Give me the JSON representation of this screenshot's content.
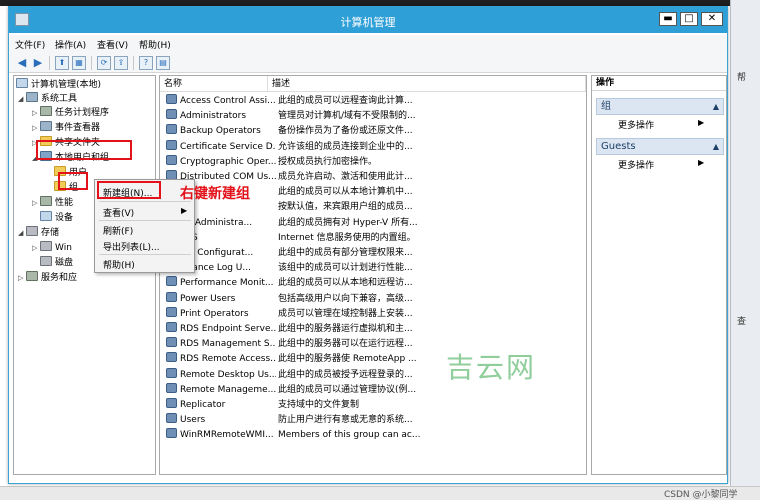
{
  "window": {
    "title": "计算机管理",
    "buttons": {
      "minimize": "▬",
      "maximize": "□",
      "close": "✕"
    }
  },
  "menu": [
    "文件(F)",
    "操作(A)",
    "查看(V)",
    "帮助(H)"
  ],
  "tree": {
    "root": "计算机管理(本地)",
    "system_tools": "系统工具",
    "task_scheduler": "任务计划程序",
    "event_viewer": "事件查看器",
    "shared_folders": "共享文件夹",
    "local_users_groups": "本地用户和组",
    "users": "用户",
    "groups": "组",
    "performance": "性能",
    "device_manager": "设备",
    "storage": "存储",
    "windows_backup": "Win",
    "disk_mgmt": "磁盘",
    "services_apps": "服务和应"
  },
  "list": {
    "headers": {
      "name": "名称",
      "desc": "描述"
    },
    "rows": [
      {
        "name": "Access Control Assi...",
        "desc": "此组的成员可以远程查询此计算..."
      },
      {
        "name": "Administrators",
        "desc": "管理员对计算机/域有不受限制的..."
      },
      {
        "name": "Backup Operators",
        "desc": "备份操作员为了备份或还原文件..."
      },
      {
        "name": "Certificate Service D...",
        "desc": "允许该组的成员连接到企业中的..."
      },
      {
        "name": "Cryptographic Oper...",
        "desc": "授权成员执行加密操作。"
      },
      {
        "name": "Distributed COM Us...",
        "desc": "成员允许启动、激活和使用此计..."
      },
      {
        "name": "...",
        "desc": "此组的成员可以从本地计算机中..."
      },
      {
        "name": "...s",
        "desc": "按默认值，来宾跟用户组的成员..."
      },
      {
        "name": "r-V Administra...",
        "desc": "此组的成员拥有对 Hyper-V 所有..."
      },
      {
        "name": "SRS",
        "desc": "Internet 信息服务使用的内置组。"
      },
      {
        "name": "ork Configurat...",
        "desc": "此组中的成员有部分管理权限来..."
      },
      {
        "name": "rmance Log U...",
        "desc": "该组中的成员可以计划进行性能..."
      },
      {
        "name": "Performance Monit...",
        "desc": "此组的成员可以从本地和远程访..."
      },
      {
        "name": "Power Users",
        "desc": "包括高级用户以向下兼容，高级..."
      },
      {
        "name": "Print Operators",
        "desc": "成员可以管理在域控制器上安装..."
      },
      {
        "name": "RDS Endpoint Serve...",
        "desc": "此组中的服务器运行虚拟机和主..."
      },
      {
        "name": "RDS Management S...",
        "desc": "此组中的服务器可以在运行远程..."
      },
      {
        "name": "RDS Remote Access...",
        "desc": "此组中的服务器使 RemoteApp ..."
      },
      {
        "name": "Remote Desktop Us...",
        "desc": "此组中的成员被授予远程登录的..."
      },
      {
        "name": "Remote Manageme...",
        "desc": "此组的成员可以通过管理协议(例..."
      },
      {
        "name": "Replicator",
        "desc": "支持域中的文件复制"
      },
      {
        "name": "Users",
        "desc": "防止用户进行有意或无意的系统..."
      },
      {
        "name": "WinRMRemoteWMI...",
        "desc": "Members of this group can ac..."
      }
    ]
  },
  "actions": {
    "header": "操作",
    "group_section": "组",
    "guests_section": "Guests",
    "more_actions": "更多操作",
    "collapse": "▲",
    "sub": "▶"
  },
  "context_menu": {
    "new_group": "新建组(N)...",
    "view": "查看(V)",
    "refresh": "刷新(F)",
    "export": "导出列表(L)...",
    "help": "帮助(H)",
    "sub_arrow": "▶"
  },
  "annotation": "右键新建组",
  "watermark": "吉云网",
  "credit": "CSDN @小黎同学",
  "desktop_right": {
    "label1": "帮",
    "label2": "查"
  },
  "colors": {
    "titlebar": "#2f9fd8",
    "annotation_red": "#e3121a",
    "watermark_green": "#7cc58a"
  }
}
